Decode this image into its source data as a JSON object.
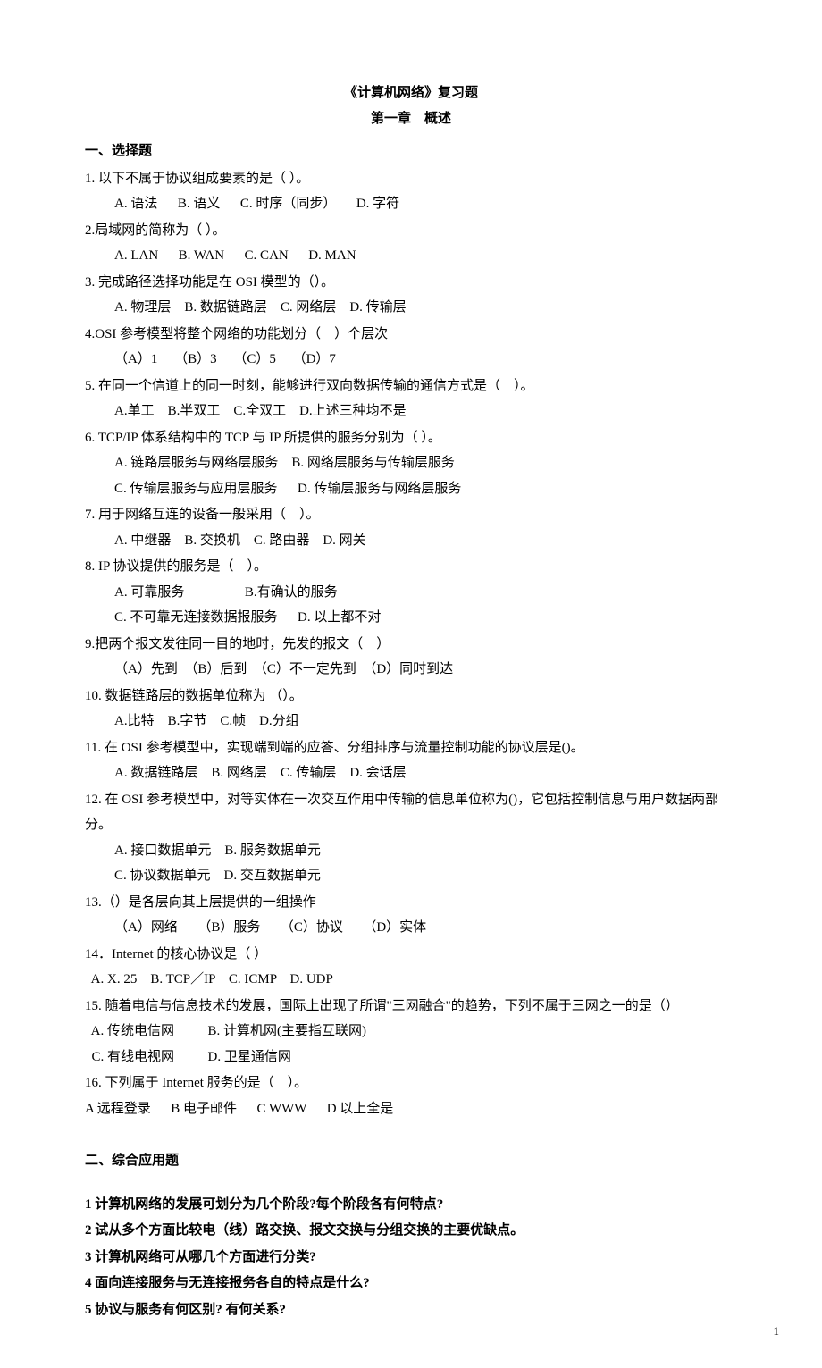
{
  "header": {
    "title": "《计算机网络》复习题",
    "subtitle": "第一章　概述"
  },
  "section1": {
    "heading": "一、选择题",
    "questions": [
      {
        "stem": "1. 以下不属于协议组成要素的是（ ）。",
        "opts": "A. 语法      B. 语义      C. 时序（同步）      D. 字符"
      },
      {
        "stem": "2.局域网的简称为（ ）。",
        "opts": "A. LAN      B. WAN      C. CAN      D. MAN"
      },
      {
        "stem": "3. 完成路径选择功能是在 OSI 模型的（）。",
        "opts": "A. 物理层    B. 数据链路层    C. 网络层    D. 传输层"
      },
      {
        "stem": "4.OSI 参考模型将整个网络的功能划分（　）个层次",
        "opts": "（A）1     （B）3     （C）5     （D）7"
      },
      {
        "stem": "5. 在同一个信道上的同一时刻，能够进行双向数据传输的通信方式是（　）。",
        "opts": "A.单工    B.半双工    C.全双工    D.上述三种均不是"
      },
      {
        "stem": "6. TCP/IP 体系结构中的 TCP 与 IP 所提供的服务分别为（ ）。",
        "opts": "A. 链路层服务与网络层服务    B. 网络层服务与传输层服务",
        "opts2": "C. 传输层服务与应用层服务      D. 传输层服务与网络层服务"
      },
      {
        "stem": "7. 用于网络互连的设备一般采用（　）。",
        "opts": "A. 中继器    B. 交换机    C. 路由器    D. 网关"
      },
      {
        "stem": "8. IP 协议提供的服务是（　）。",
        "opts": "A. 可靠服务                  B.有确认的服务",
        "opts2": "C. 不可靠无连接数据报服务      D. 以上都不对"
      },
      {
        "stem": "9.把两个报文发往同一目的地时，先发的报文（　）",
        "opts": "（A）先到  （B）后到  （C）不一定先到  （D）同时到达"
      },
      {
        "stem": "10. 数据链路层的数据单位称为 （）。",
        "opts": "A.比特    B.字节    C.帧    D.分组"
      },
      {
        "stem": "11. 在 OSI 参考模型中，实现端到端的应答、分组排序与流量控制功能的协议层是()。",
        "opts": "A. 数据链路层    B. 网络层    C. 传输层    D. 会话层"
      },
      {
        "stem": "12. 在 OSI 参考模型中，对等实体在一次交互作用中传输的信息单位称为()，它包括控制信息与用户数据两部分。",
        "opts": "A. 接口数据单元    B. 服务数据单元",
        "opts2": "C. 协议数据单元    D. 交互数据单元"
      },
      {
        "stem": "13.（）是各层向其上层提供的一组操作",
        "opts": "（A）网络      （B）服务      （C）协议      （D）实体"
      },
      {
        "stem": "14．Internet 的核心协议是（ ）",
        "opts_inline": "  A. X. 25    B. TCP／IP    C. ICMP    D. UDP"
      },
      {
        "stem": "15. 随着电信与信息技术的发展，国际上出现了所谓\"三网融合\"的趋势，下列不属于三网之一的是（）",
        "opts_inline": "  A. 传统电信网          B. 计算机网(主要指互联网)",
        "opts_inline2": "  C. 有线电视网          D. 卫星通信网"
      },
      {
        "stem": "16. 下列属于 Internet 服务的是（　）。",
        "opts_q16": "A 远程登录      B 电子邮件      C WWW      D 以上全是"
      }
    ]
  },
  "section2": {
    "heading": "二、综合应用题",
    "questions": [
      "1 计算机网络的发展可划分为几个阶段?每个阶段各有何特点?",
      "2 试从多个方面比较电（线）路交换、报文交换与分组交换的主要优缺点。",
      "3 计算机网络可从哪几个方面进行分类?",
      "4 面向连接服务与无连接报务各自的特点是什么?",
      "5 协议与服务有何区别? 有何关系?"
    ]
  },
  "pageNumber": "1"
}
